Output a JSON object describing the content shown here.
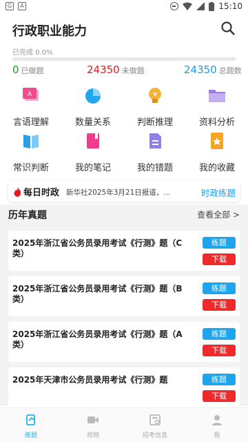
{
  "statusbar": {
    "time": "15:10",
    "left_icons": [
      "g-icon",
      "a-icon"
    ]
  },
  "header": {
    "title": "行政职业能力"
  },
  "progress": {
    "label": "已完成 0.0%",
    "fraction": 0.0
  },
  "stats": [
    {
      "value": "0",
      "label": "已做题",
      "color": "#1aa31a"
    },
    {
      "value": "24350",
      "label": "未做题",
      "color": "#e8191c"
    },
    {
      "value": "24350",
      "label": "总题数",
      "color": "#1e9be9"
    }
  ],
  "categories": [
    {
      "label": "言语理解",
      "icon": "language-icon",
      "color": "#f04b8a"
    },
    {
      "label": "数量关系",
      "icon": "pie-chart-icon",
      "color": "#22a7ee"
    },
    {
      "label": "判断推理",
      "icon": "lightbulb-icon",
      "color": "#f4a22c"
    },
    {
      "label": "资料分析",
      "icon": "folder-icon",
      "color": "#9d7be6"
    },
    {
      "label": "常识判断",
      "icon": "book-icon",
      "color": "#2b9fe6"
    },
    {
      "label": "我的笔记",
      "icon": "notebook-icon",
      "color": "#ef3b8c"
    },
    {
      "label": "我的错题",
      "icon": "document-icon",
      "color": "#8f7fe8"
    },
    {
      "label": "我的收藏",
      "icon": "bookmark-star-icon",
      "color": "#f5a425"
    }
  ],
  "news": {
    "tag": "每日时政",
    "text": "新华社2025年3月21日报道，...",
    "link": "时政练题"
  },
  "section": {
    "title": "历年真题",
    "more": "查看全部 >"
  },
  "papers": [
    {
      "title": "2025年浙江省公务员录用考试《行测》题（C类）"
    },
    {
      "title": "2025年浙江省公务员录用考试《行测》题（B类）"
    },
    {
      "title": "2025年浙江省公务员录用考试《行测》题（A类）"
    },
    {
      "title": "2025年天津市公务员录用考试《行测》题"
    }
  ],
  "buttons": {
    "practice": "练题",
    "download": "下载"
  },
  "tabs": [
    {
      "label": "练题",
      "icon": "practice-icon",
      "active": true
    },
    {
      "label": "视频",
      "icon": "video-icon",
      "active": false
    },
    {
      "label": "招考信息",
      "icon": "news-icon",
      "active": false
    },
    {
      "label": "我",
      "icon": "user-icon",
      "active": false
    }
  ],
  "colors": {
    "accent": "#1e9be9",
    "danger": "#ef2a2a",
    "tab_active": "#24b4e8"
  }
}
